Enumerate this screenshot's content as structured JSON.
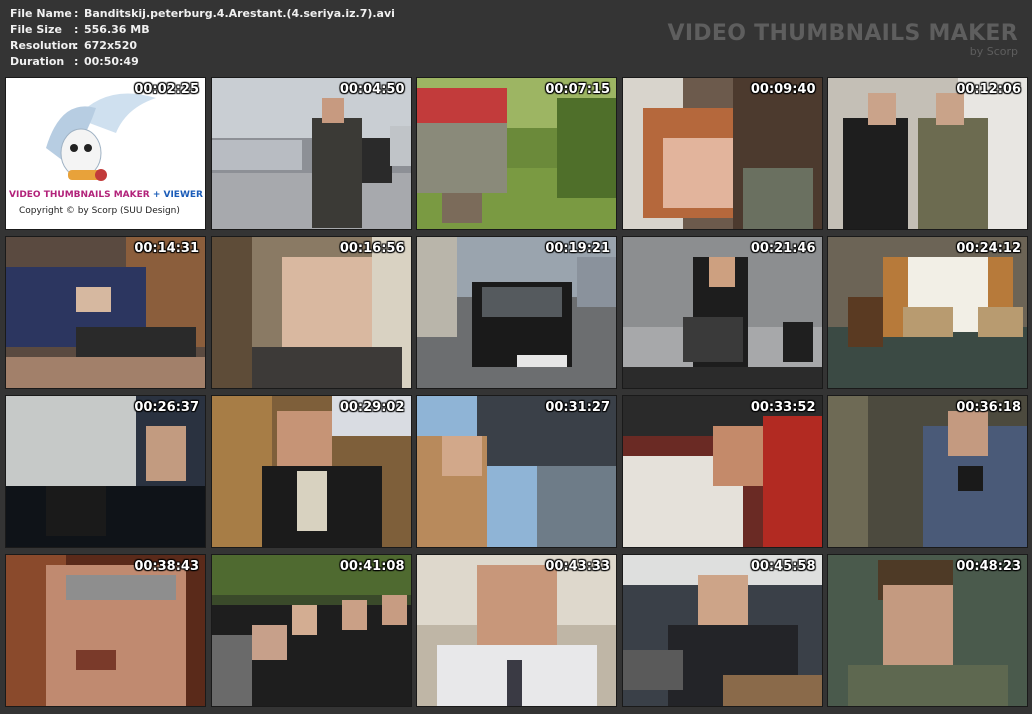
{
  "meta": {
    "file_name_key": "File Name",
    "file_name": "Banditskij.peterburg.4.Arestant.(4.seriya.iz.7).avi",
    "file_size_key": "File Size",
    "file_size": "556.36 MB",
    "resolution_key": "Resolution",
    "resolution": "672x520",
    "duration_key": "Duration",
    "duration": "00:50:49",
    "separator": ":"
  },
  "brand": {
    "title": "VIDEO THUMBNAILS MAKER",
    "subtitle": "by Scorp"
  },
  "logo": {
    "title_main": "VIDEO THUMBNAILS MAKER",
    "title_plus": " + VIEWER",
    "copyright": "Copyright © by Scorp (SUU Design)"
  },
  "thumbnails": [
    {
      "time": "00:02:25",
      "scene": "logo"
    },
    {
      "time": "00:04:50",
      "scene": "street-parking-lot"
    },
    {
      "time": "00:07:15",
      "scene": "park-flower-urn"
    },
    {
      "time": "00:09:40",
      "scene": "embrace-closeup"
    },
    {
      "time": "00:12:06",
      "scene": "two-men-room"
    },
    {
      "time": "00:14:31",
      "scene": "sleeping-with-phone"
    },
    {
      "time": "00:16:56",
      "scene": "older-man-closeup"
    },
    {
      "time": "00:19:21",
      "scene": "black-car-street"
    },
    {
      "time": "00:21:46",
      "scene": "woman-at-safe-boxes"
    },
    {
      "time": "00:24:12",
      "scene": "hotel-room"
    },
    {
      "time": "00:26:37",
      "scene": "man-in-car"
    },
    {
      "time": "00:29:02",
      "scene": "bald-man-suit"
    },
    {
      "time": "00:31:27",
      "scene": "man-under-lamp"
    },
    {
      "time": "00:33:52",
      "scene": "man-lying-red-seat"
    },
    {
      "time": "00:36:18",
      "scene": "man-denim-jacket"
    },
    {
      "time": "00:38:43",
      "scene": "old-man-face-closeup"
    },
    {
      "time": "00:41:08",
      "scene": "funeral-crowd"
    },
    {
      "time": "00:43:33",
      "scene": "bald-mustache-man"
    },
    {
      "time": "00:45:58",
      "scene": "man-on-phone-office"
    },
    {
      "time": "00:48:23",
      "scene": "young-man-portrait"
    }
  ]
}
